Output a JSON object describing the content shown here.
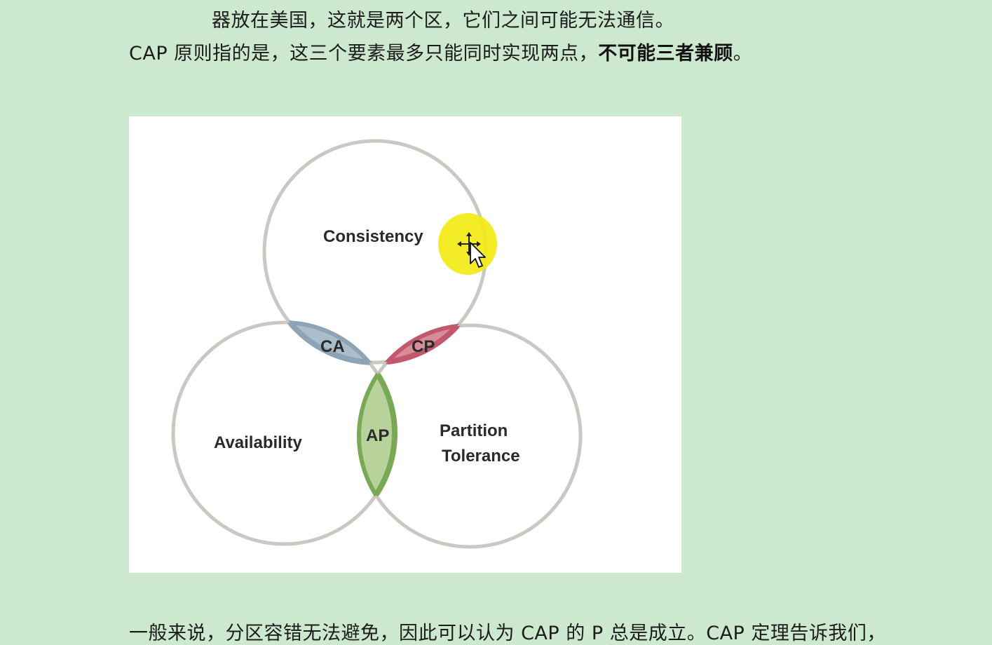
{
  "document": {
    "line_1": "器放在美国，这就是两个区，它们之间可能无法通信。",
    "line_2_prefix": "CAP 原则指的是，这三个要素最多只能同时实现两点，",
    "line_2_bold": "不可能三者兼顾",
    "line_2_suffix": "。",
    "line_3": "一般来说，分区容错无法避免，因此可以认为 CAP 的 P 总是成立。CAP 定理告诉我们，"
  },
  "figure": {
    "circles": {
      "consistency": "Consistency",
      "availability": "Availability",
      "partition_line1": "Partition",
      "partition_line2": "Tolerance"
    },
    "intersections": {
      "ca": "CA",
      "cp": "CP",
      "ap": "AP"
    },
    "colors": {
      "circle_stroke": "#c9c8c3",
      "ca_fill": "#a9bdcb",
      "ca_stroke": "#8ea3b3",
      "cp_fill": "#d88b99",
      "cp_stroke": "#c2586c",
      "ap_fill": "#b7d39b",
      "ap_stroke": "#7aa955",
      "cursor_highlight": "#f2ea14"
    }
  },
  "cursor": {
    "icon": "move-cursor-icon"
  }
}
